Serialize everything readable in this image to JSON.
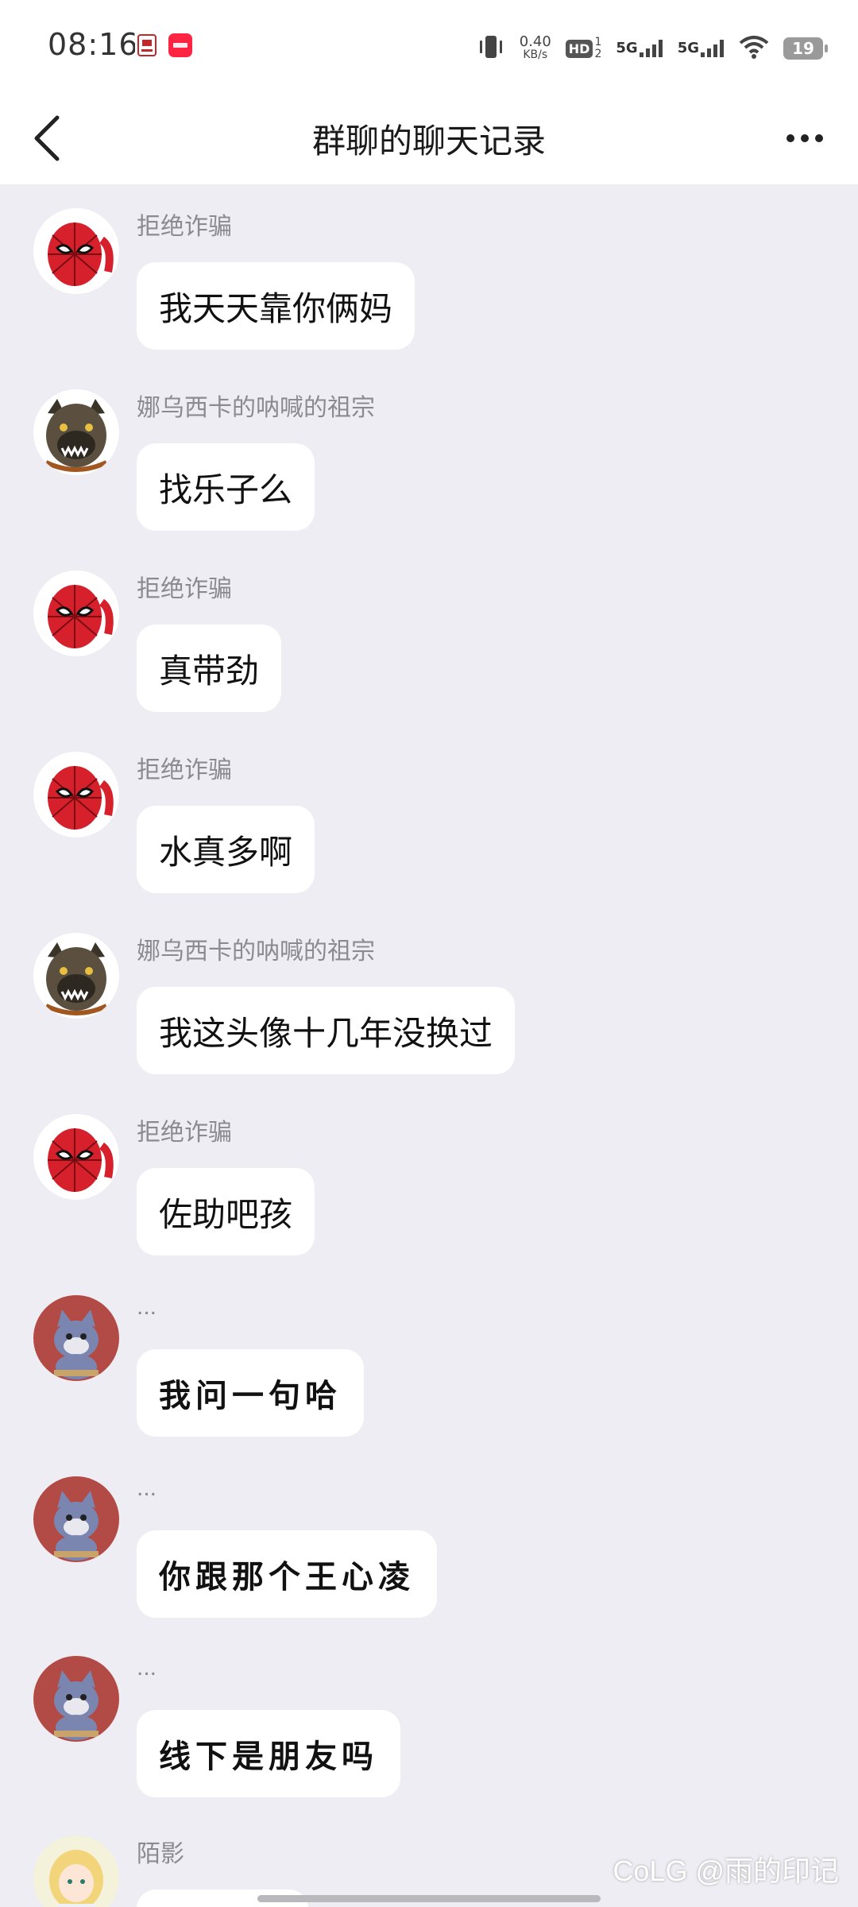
{
  "status_bar": {
    "time": "08:16",
    "net_speed_value": "0.40",
    "net_speed_unit": "KB/s",
    "hd_label": "HD",
    "sim1_label": "5G",
    "sim2_label": "5G",
    "battery_level": "19",
    "app_icons": [
      "app-notification-icon-1",
      "xiaohongshu-icon"
    ]
  },
  "header": {
    "title": "群聊的聊天记录",
    "back_icon": "chevron-left-icon",
    "more_icon": "more-dots-icon"
  },
  "messages": [
    {
      "sender": "拒绝诈骗",
      "text": "我天天靠你俩妈",
      "avatar": "spiderman-avatar"
    },
    {
      "sender": "娜乌西卡的呐喊的祖宗",
      "text": "找乐子么",
      "avatar": "bulldog-avatar"
    },
    {
      "sender": "拒绝诈骗",
      "text": "真带劲",
      "avatar": "spiderman-avatar"
    },
    {
      "sender": "拒绝诈骗",
      "text": "水真多啊",
      "avatar": "spiderman-avatar"
    },
    {
      "sender": "娜乌西卡的呐喊的祖宗",
      "text": "我这头像十几年没换过",
      "avatar": "bulldog-avatar"
    },
    {
      "sender": "拒绝诈骗",
      "text": "佐助吧孩",
      "avatar": "spiderman-avatar"
    },
    {
      "sender": "...",
      "text": "我问一句哈",
      "avatar": "tom-cat-avatar"
    },
    {
      "sender": "...",
      "text": "你跟那个王心凌",
      "avatar": "tom-cat-avatar"
    },
    {
      "sender": "...",
      "text": "线下是朋友吗",
      "avatar": "tom-cat-avatar"
    },
    {
      "sender": "陌影",
      "text": "",
      "avatar": "anime-girl-avatar"
    }
  ],
  "watermark": "CoLG @雨的印记",
  "colors": {
    "background": "#ededf3",
    "bubble": "#ffffff",
    "sender_name": "#8a8a8f",
    "spiderman_red": "#d6202c",
    "tom_bg": "#b24a45"
  }
}
